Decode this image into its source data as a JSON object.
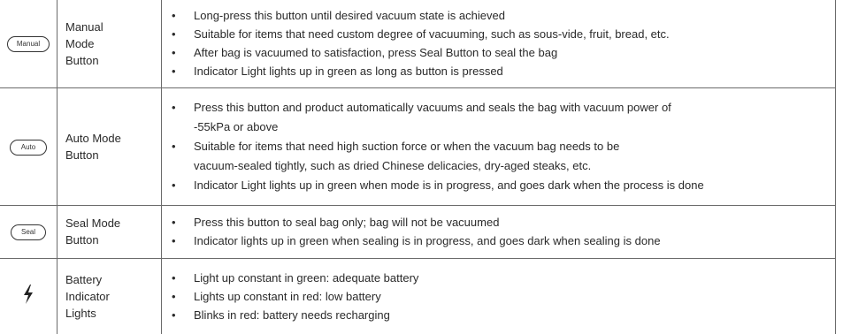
{
  "rows": [
    {
      "icon_label": "Manual",
      "name": [
        "Manual",
        "Mode",
        "Button"
      ],
      "bullets": [
        "Long-press this button until desired vacuum state is achieved",
        "Suitable for items that need custom degree of vacuuming, such as sous-vide, fruit, bread, etc.",
        "After bag is vacuumed to satisfaction, press Seal Button to seal the bag",
        "Indicator Light lights up in green as long as button is pressed"
      ]
    },
    {
      "icon_label": "Auto",
      "name": [
        "Auto Mode",
        "Button"
      ],
      "bullets": [
        [
          "Press this button and product automatically vacuums and seals the bag with vacuum power of",
          "-55kPa or above"
        ],
        [
          "Suitable for items that need high suction force or when the vacuum bag needs to be",
          "vacuum-sealed tightly, such as dried Chinese delicacies, dry-aged steaks, etc."
        ],
        [
          "Indicator Light lights up in green when mode is in progress, and goes dark when the process is done"
        ]
      ]
    },
    {
      "icon_label": "Seal",
      "name": [
        "Seal Mode",
        "Button"
      ],
      "bullets": [
        "Press this button to seal bag only; bag will not be vacuumed",
        "Indicator lights up in green when sealing is in progress, and goes dark when sealing is done"
      ]
    },
    {
      "icon": "lightning-bolt-icon",
      "name": [
        "Battery",
        "Indicator",
        "Lights"
      ],
      "bullets": [
        "Light up constant in green: adequate battery",
        "Lights up constant in red: low battery",
        "Blinks in red: battery needs recharging"
      ]
    }
  ]
}
